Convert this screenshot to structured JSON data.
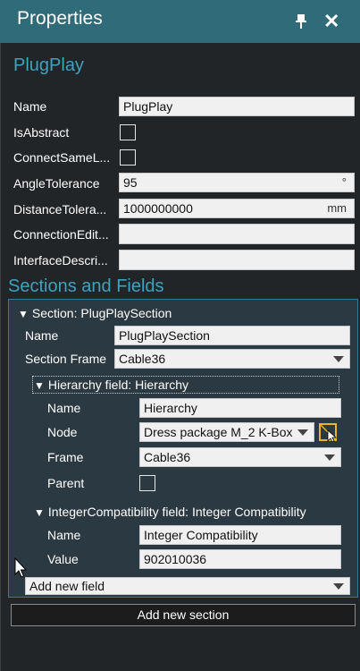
{
  "panel": {
    "title": "Properties",
    "object_name": "PlugPlay"
  },
  "properties": {
    "name_label": "Name",
    "name_value": "PlugPlay",
    "isabstract_label": "IsAbstract",
    "isabstract_checked": false,
    "connectsame_label": "ConnectSameL...",
    "connectsame_checked": false,
    "angle_label": "AngleTolerance",
    "angle_value": "95",
    "angle_unit": "°",
    "distance_label": "DistanceTolera...",
    "distance_value": "1000000000",
    "distance_unit": "mm",
    "connection_label": "ConnectionEdit...",
    "connection_value": "",
    "interface_label": "InterfaceDescri...",
    "interface_value": ""
  },
  "sections": {
    "heading": "Sections and Fields",
    "section_header": "Section: PlugPlaySection",
    "name_label": "Name",
    "name_value": "PlugPlaySection",
    "frame_label": "Section Frame",
    "frame_value": "Cable36",
    "hierarchy": {
      "header": "Hierarchy field: Hierarchy",
      "name_label": "Name",
      "name_value": "Hierarchy",
      "node_label": "Node",
      "node_value": "Dress package M_2 K-Box",
      "frame_label": "Frame",
      "frame_value": "Cable36",
      "parent_label": "Parent",
      "parent_checked": false
    },
    "integer": {
      "header": "IntegerCompatibility field: Integer Compatibility",
      "name_label": "Name",
      "name_value": "Integer Compatibility",
      "value_label": "Value",
      "value_value": "902010036"
    },
    "add_field_value": "Add new field",
    "add_section_label": "Add new section"
  },
  "icons": {
    "pin": "pin-icon",
    "close": "close-icon",
    "node_pick": "node-pick-icon",
    "cursor": "mouse-cursor"
  },
  "colors": {
    "titlebar": "#2f6b79",
    "accent_text": "#3ea3bd",
    "section_bg": "#2b3a42",
    "section_border": "#35779a",
    "node_icon": "#e6b430"
  }
}
